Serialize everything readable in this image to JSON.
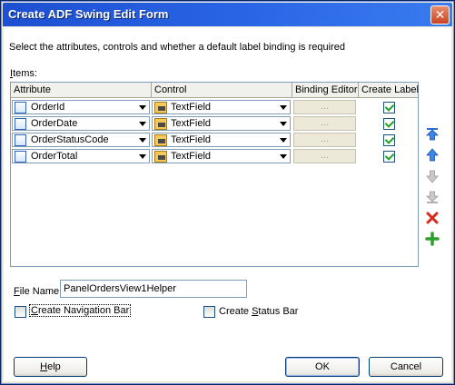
{
  "window": {
    "title": "Create ADF Swing Edit Form",
    "close_glyph": "✕"
  },
  "instructions": "Select the attributes, controls and whether a default label binding is required",
  "items_label": {
    "mnemonic": "I",
    "rest": "tems:"
  },
  "table": {
    "columns": [
      "Attribute",
      "Control",
      "Binding Editor",
      "Create Label"
    ],
    "rows": [
      {
        "attribute": "OrderId",
        "control": "TextField",
        "binding": "...",
        "create_label": true
      },
      {
        "attribute": "OrderDate",
        "control": "TextField",
        "binding": "...",
        "create_label": true
      },
      {
        "attribute": "OrderStatusCode",
        "control": "TextField",
        "binding": "...",
        "create_label": true
      },
      {
        "attribute": "OrderTotal",
        "control": "TextField",
        "binding": "...",
        "create_label": true
      }
    ]
  },
  "side_buttons": [
    "move-top-icon",
    "move-up-icon",
    "move-down-icon",
    "move-bottom-icon",
    "delete-icon",
    "add-icon"
  ],
  "file_name": {
    "label_mnemonic": "F",
    "label_rest": "ile Name",
    "value": "PanelOrdersView1Helper"
  },
  "options": {
    "navigation_bar": {
      "pre": "",
      "mnemonic": "C",
      "rest": "reate Navigation Bar",
      "checked": false
    },
    "status_bar": {
      "pre": "Create ",
      "mnemonic": "S",
      "rest": "tatus Bar",
      "checked": false
    }
  },
  "buttons": {
    "help": {
      "mnemonic": "H",
      "rest": "elp"
    },
    "ok": "OK",
    "cancel": "Cancel"
  },
  "colors": {
    "titlebar": "#2966e6",
    "accent": "#003c74",
    "check": "#21a121"
  }
}
